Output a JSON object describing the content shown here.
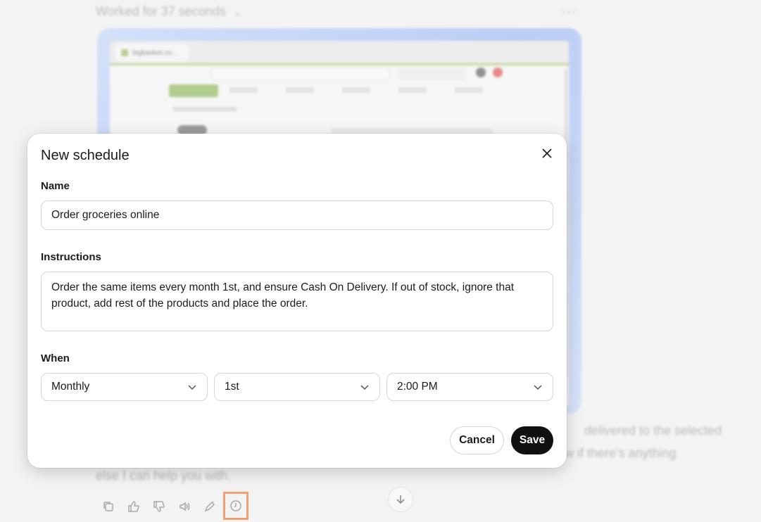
{
  "chat": {
    "worked_label": "Worked for 37 seconds",
    "message_line_1": "delivered to the selected",
    "message_line_2": "w if there's anything",
    "message_line_3": "else I can help you with."
  },
  "screenshot": {
    "tab_title": "bigbasket.co..."
  },
  "modal": {
    "title": "New schedule",
    "name_label": "Name",
    "name_value": "Order groceries online",
    "instructions_label": "Instructions",
    "instructions_value": "Order the same items every month 1st, and ensure Cash On Delivery. If out of stock, ignore that product, add rest of the products and place the order.",
    "when_label": "When",
    "frequency": "Monthly",
    "day": "1st",
    "time": "2:00 PM",
    "cancel_label": "Cancel",
    "save_label": "Save"
  },
  "icons": {
    "close": "close-icon",
    "chevron": "chevron-down-icon",
    "copy": "copy-icon",
    "thumbs_up": "thumbs-up-icon",
    "thumbs_down": "thumbs-down-icon",
    "speaker": "speaker-icon",
    "edit": "edit-icon",
    "schedule": "clock-icon",
    "arrow_down": "arrow-down-icon"
  },
  "colors": {
    "highlight": "#f26a1b",
    "save_button": "#111111"
  }
}
